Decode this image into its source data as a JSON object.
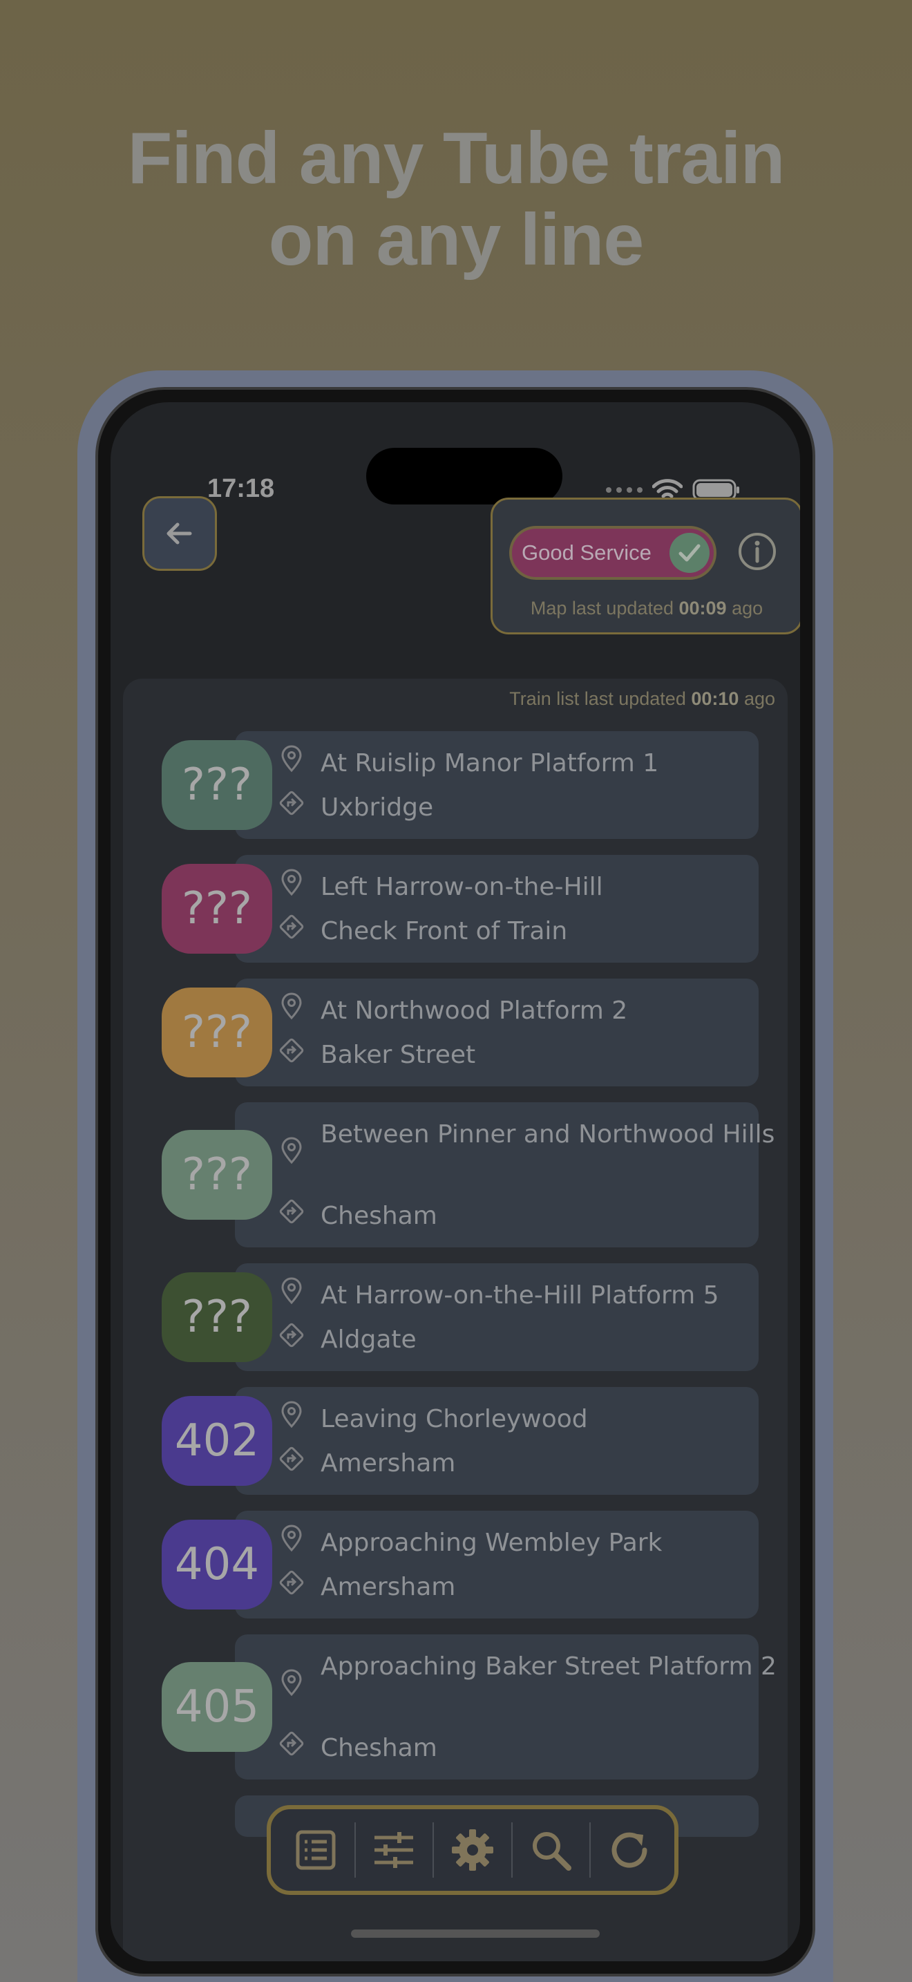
{
  "headline": {
    "line1": "Find any Tube train",
    "line2": "on any line"
  },
  "status_bar": {
    "time": "17:18"
  },
  "header": {
    "back_icon": "arrow-left-icon",
    "service_status": "Good Service",
    "service_icon": "check-icon",
    "info_icon": "info-icon",
    "map_updated_prefix": "Map last updated",
    "map_updated_value": "00:09",
    "map_updated_suffix": "ago"
  },
  "train_list": {
    "updated_prefix": "Train list last updated",
    "updated_value": "00:10",
    "updated_suffix": "ago",
    "trains": [
      {
        "badge": "???",
        "location": "At Ruislip Manor Platform 1",
        "destination": "Uxbridge",
        "badge_color": "#4e6b60"
      },
      {
        "badge": "???",
        "location": "Left Harrow-on-the-Hill",
        "destination": "Check Front of Train",
        "badge_color": "#7d3558"
      },
      {
        "badge": "???",
        "location": "At Northwood Platform 2",
        "destination": "Baker Street",
        "badge_color": "#a07940"
      },
      {
        "badge": "???",
        "location": "Between Pinner and Northwood Hills",
        "destination": "Chesham",
        "badge_color": "#66806f"
      },
      {
        "badge": "???",
        "location": "At Harrow-on-the-Hill Platform 5",
        "destination": "Aldgate",
        "badge_color": "#3d5032"
      },
      {
        "badge": "402",
        "location": "Leaving Chorleywood",
        "destination": "Amersham",
        "badge_color": "#4a3a8e"
      },
      {
        "badge": "404",
        "location": "Approaching Wembley Park",
        "destination": "Amersham",
        "badge_color": "#4a3a8e"
      },
      {
        "badge": "405",
        "location": "Approaching Baker Street Platform 2",
        "destination": "Chesham",
        "badge_color": "#66806f"
      }
    ]
  },
  "toolbar": {
    "items": [
      "list-icon",
      "sliders-icon",
      "gear-icon",
      "search-icon",
      "refresh-icon"
    ]
  },
  "colors": {
    "accent_border": "#7a6b3a",
    "card_bg": "#363d47",
    "screen_bg": "#222427"
  }
}
